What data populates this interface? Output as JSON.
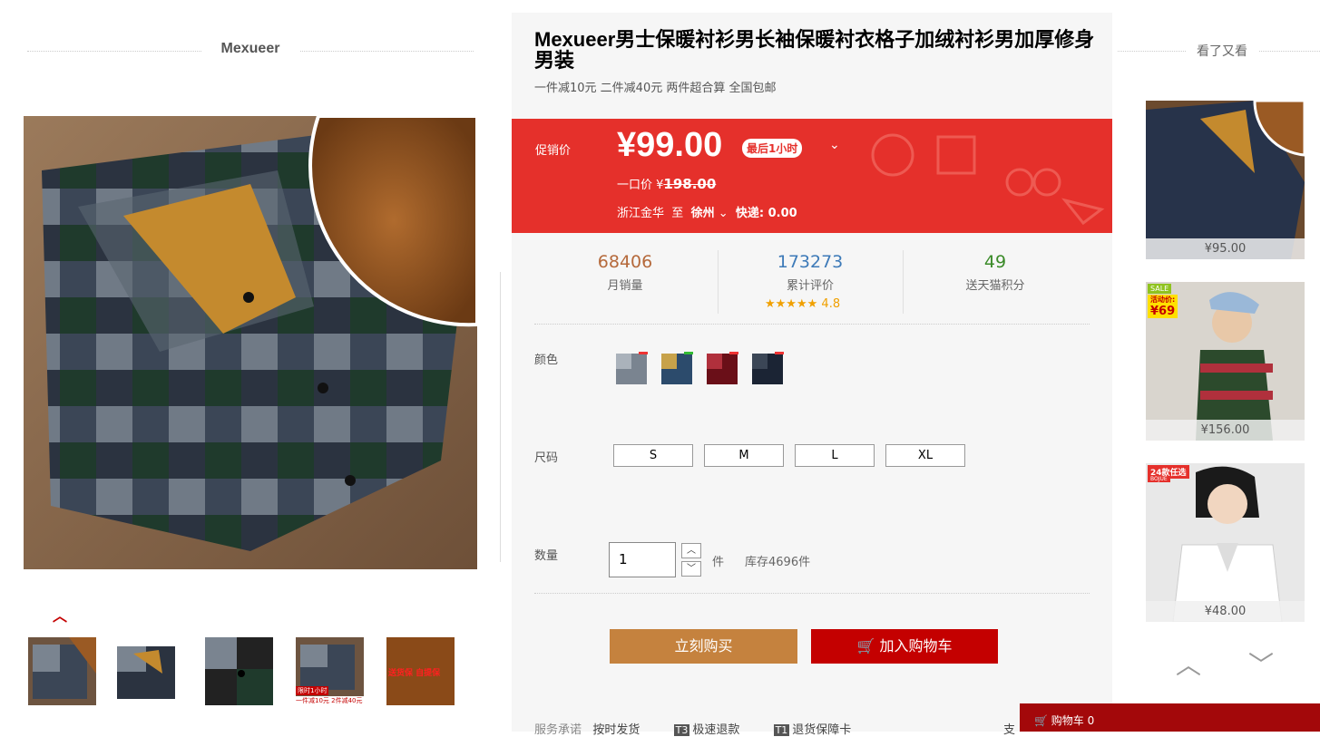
{
  "gallery": {
    "brand": "Mexueer",
    "thumbs": [
      {
        "name": "thumb-1"
      },
      {
        "name": "thumb-2"
      },
      {
        "name": "thumb-3"
      },
      {
        "name": "thumb-4",
        "overlay_line1": "限时1小时",
        "overlay_line2": "一件减10元 2件减40元"
      },
      {
        "name": "thumb-5",
        "overlay": "送货保 自提保"
      }
    ]
  },
  "product": {
    "title": "Mexueer男士保暖衬衫男长袖保暖衬衣格子加绒衬衫男加厚修身男装",
    "subtitle": "一件减10元 二件减40元 两件超合算 全国包邮",
    "price_label": "促销价",
    "price": "¥99.00",
    "price_badge": "最后1小时",
    "orig_label": "一口价 ¥",
    "orig_price": "198.00",
    "ship_from": "浙江金华",
    "ship_to_word": "至",
    "ship_to": "徐州",
    "express": "快递: 0.00"
  },
  "stats": [
    {
      "value": "68406",
      "label": "月销量",
      "color": "#b5693b"
    },
    {
      "value": "173273",
      "label": "累计评价",
      "color": "#3d7ab8"
    },
    {
      "value": "49",
      "label": "送天猫积分",
      "color": "#3a8a28"
    }
  ],
  "rating": {
    "stars": "★★★★★",
    "score": "4.8"
  },
  "options": {
    "color_label": "颜色",
    "size_label": "尺码",
    "sizes": [
      "S",
      "M",
      "L",
      "XL"
    ],
    "qty_label": "数量",
    "qty_value": "1",
    "qty_unit": "件",
    "stock": "库存4696件"
  },
  "actions": {
    "buy_now": "立刻购买",
    "add_cart": "加入购物车"
  },
  "service": {
    "label": "服务承诺",
    "items": [
      {
        "icon": "",
        "text": "按时发货"
      },
      {
        "icon": "T3",
        "text": "极速退款"
      },
      {
        "icon": "T1",
        "text": "退货保障卡"
      }
    ],
    "cut_text": "支"
  },
  "recommend": {
    "title": "看了又看",
    "items": [
      {
        "price": "¥95.00"
      },
      {
        "price": "¥156.00",
        "badge_top": "SALE",
        "badge_mid": "活动价:",
        "badge_price": "¥69"
      },
      {
        "price": "¥48.00",
        "badge_top": "24款任选",
        "badge_sub": "BOJUE"
      }
    ]
  },
  "cart_bar": {
    "label": "购物车",
    "count": "0"
  }
}
